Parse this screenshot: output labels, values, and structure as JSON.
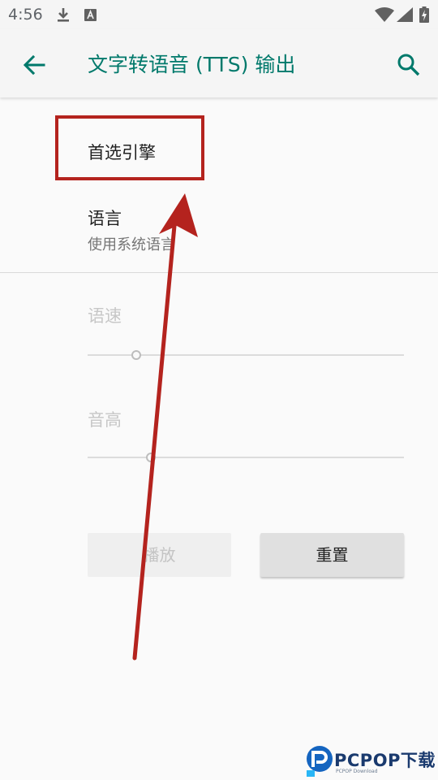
{
  "status_bar": {
    "time": "4:56"
  },
  "app_bar": {
    "title": "文字转语音 (TTS) 输出"
  },
  "preferences": {
    "engine": {
      "title": "首选引擎"
    },
    "language": {
      "title": "语言",
      "summary": "使用系统语言"
    }
  },
  "sliders": {
    "rate": {
      "label": "语速"
    },
    "pitch": {
      "label": "音高"
    }
  },
  "buttons": {
    "play": "播放",
    "reset": "重置"
  },
  "watermark": {
    "brand": "PCPOP下载",
    "sub": "PCPOP Download"
  },
  "colors": {
    "accent": "#00796b",
    "annotation": "#b4231e"
  }
}
